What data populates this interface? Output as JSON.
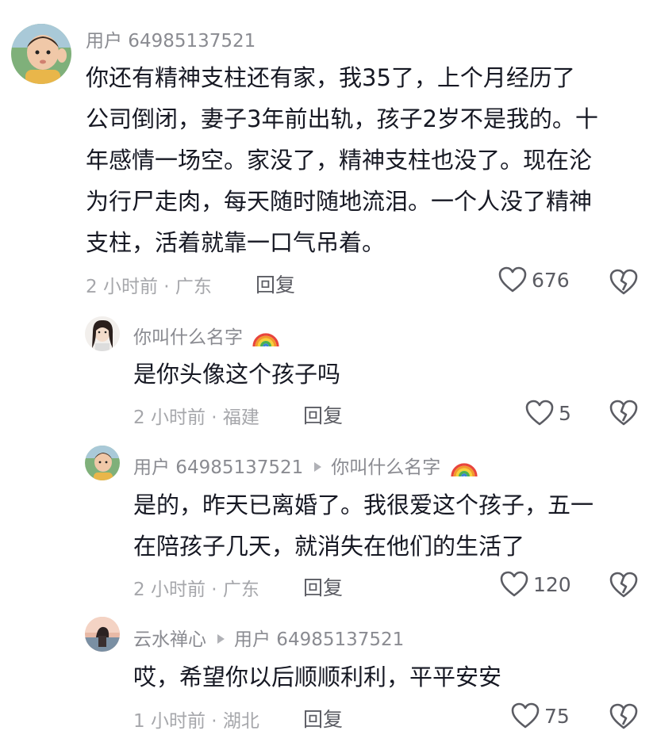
{
  "comments": [
    {
      "user": "用户 64985137521",
      "lines": [
        "你还有精神支柱还有家，我35了，上个月经历了",
        "公司倒闭，妻子3年前出轨，孩子2岁不是我的。十",
        "年感情一场空。家没了，精神支柱也没了。现在沦",
        "为行尸走肉，每天随时随地流泪。一个人没了精神",
        "支柱，活着就靠一口气吊着。"
      ],
      "time": "2 小时前 · 广东",
      "reply": "回复",
      "likes": "676"
    },
    {
      "user": "你叫什么名字",
      "lines": [
        "是你头像这个孩子吗"
      ],
      "time": "2 小时前 · 福建",
      "reply": "回复",
      "likes": "5"
    },
    {
      "user": "用户 64985137521",
      "reply_to": "你叫什么名字",
      "lines": [
        "是的，昨天已离婚了。我很爱这个孩子，五一",
        "在陪孩子几天，就消失在他们的生活了"
      ],
      "time": "2 小时前 · 广东",
      "reply": "回复",
      "likes": "120"
    },
    {
      "user": "云水禅心",
      "reply_to": "用户 64985137521",
      "lines": [
        "哎，希望你以后顺顺利利，平平安安"
      ],
      "time": "1 小时前 · 湖北",
      "reply": "回复",
      "likes": "75"
    }
  ]
}
